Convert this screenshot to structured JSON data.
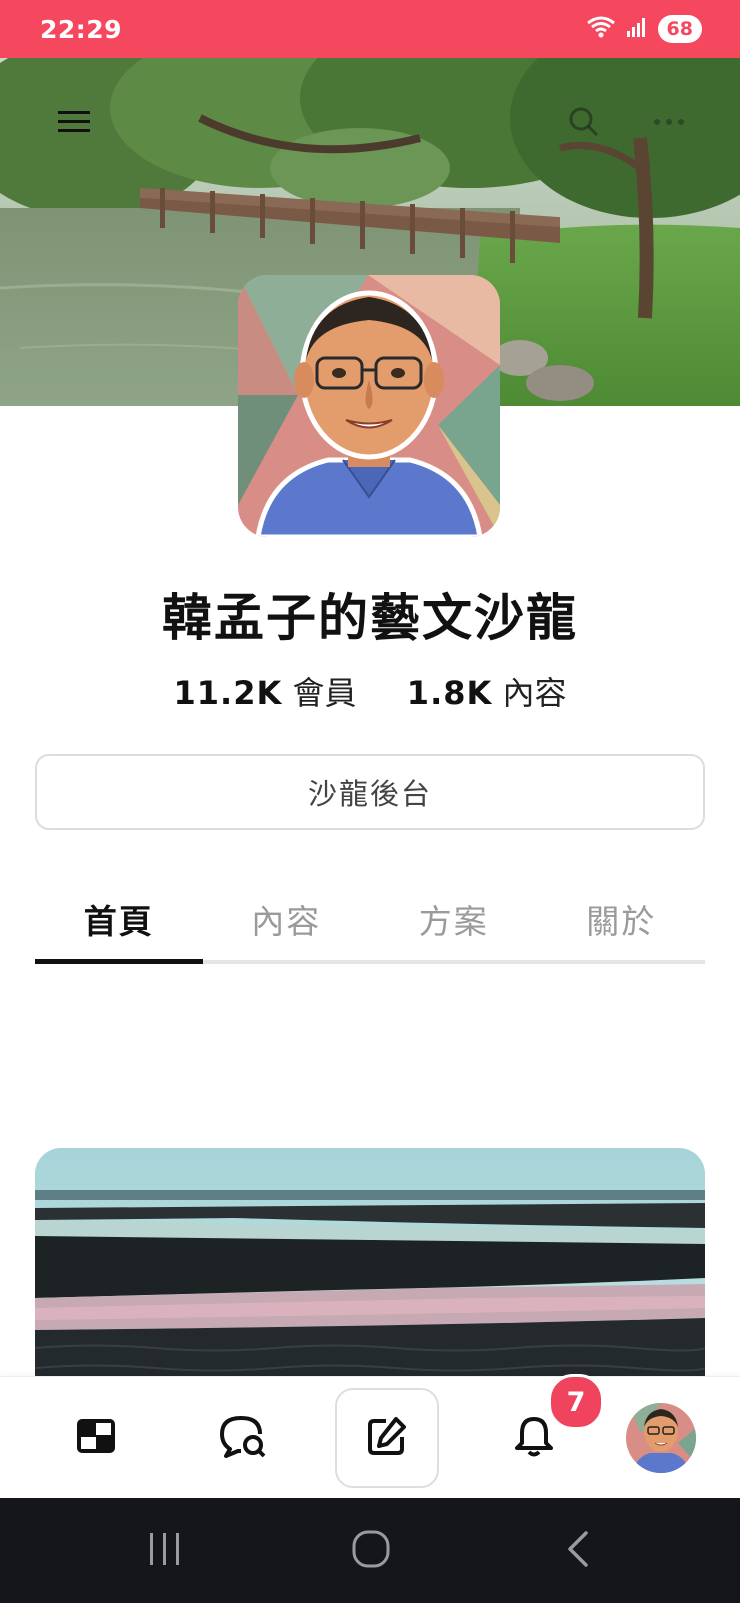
{
  "status_bar": {
    "time": "22:29",
    "battery": "68",
    "icons": [
      "wifi-icon",
      "signal-icon"
    ],
    "background": "#f5485f"
  },
  "cover": {
    "description_icons": [
      "menu-icon",
      "search-icon",
      "more-icon"
    ]
  },
  "profile": {
    "name": "韓孟子的藝文沙龍",
    "members_count": "11.2K",
    "members_label": "會員",
    "content_count": "1.8K",
    "content_label": "內容"
  },
  "admin_button": {
    "label": "沙龍後台"
  },
  "tabs": [
    {
      "label": "首頁",
      "active": true
    },
    {
      "label": "內容",
      "active": false
    },
    {
      "label": "方案",
      "active": false
    },
    {
      "label": "關於",
      "active": false
    }
  ],
  "bottom_nav": {
    "items": [
      "home-icon",
      "chat-icon",
      "compose-icon",
      "bell-icon",
      "profile-avatar"
    ],
    "notification_badge": "7"
  },
  "system_nav": {
    "items": [
      "recents-icon",
      "home-circle-icon",
      "back-icon"
    ]
  },
  "colors": {
    "accent": "#f5485f",
    "badge": "#f0435e",
    "tab_active": "#111111",
    "tab_inactive": "#9a9a9a"
  }
}
